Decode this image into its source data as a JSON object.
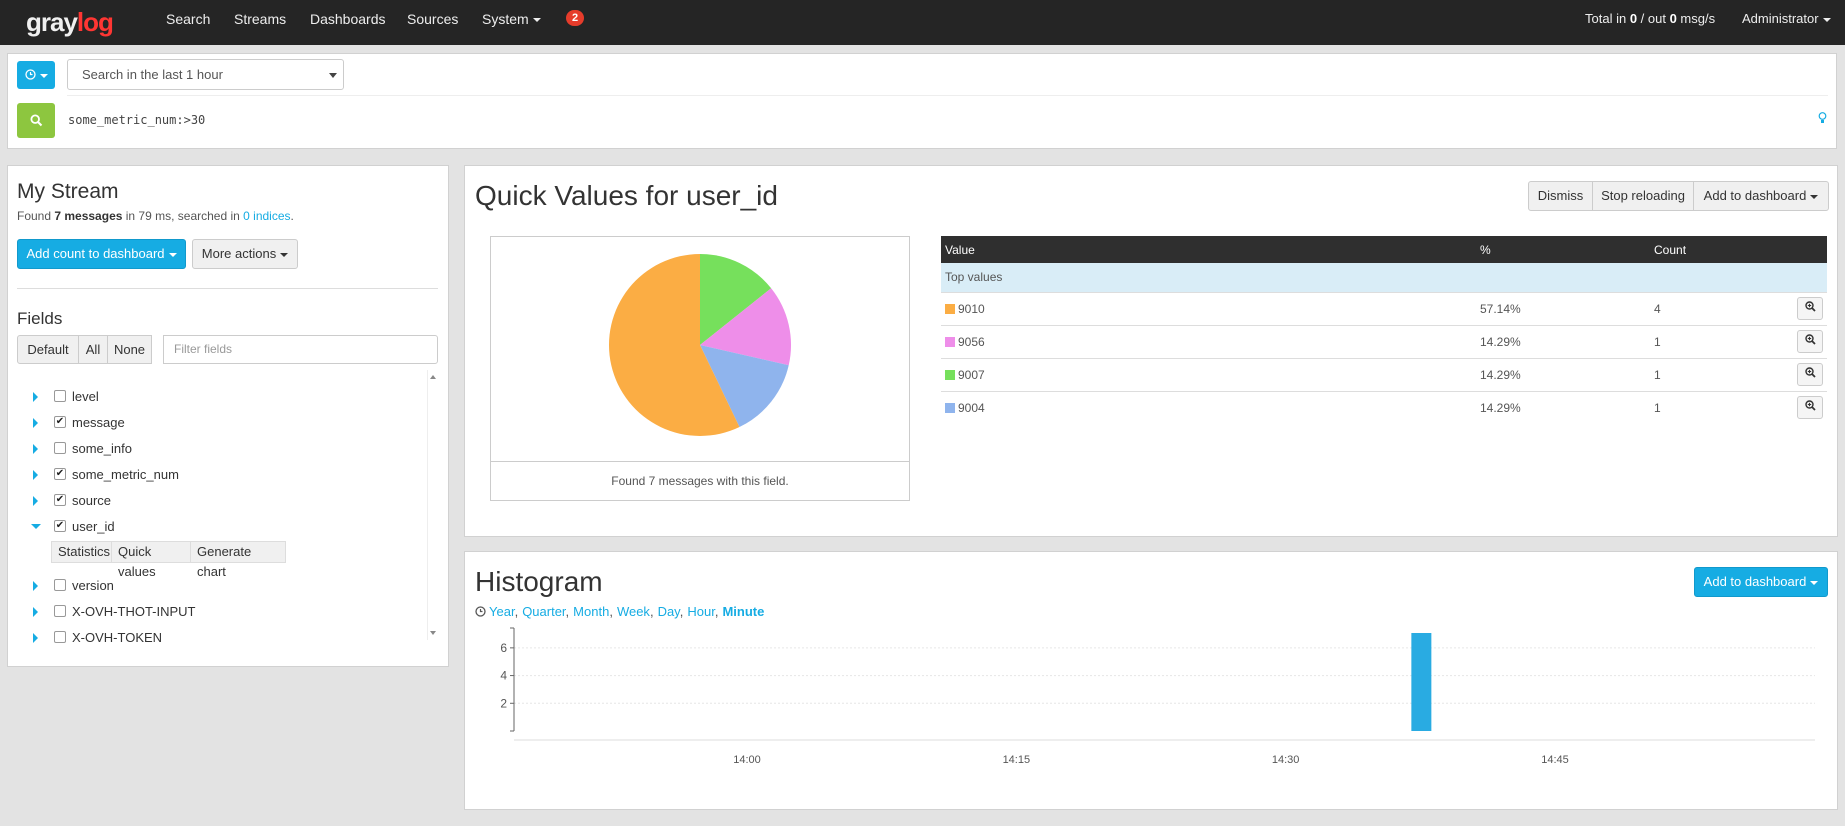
{
  "navbar": {
    "logo_gray": "gray",
    "logo_log": "log",
    "links": [
      "Search",
      "Streams",
      "Dashboards",
      "Sources",
      "System"
    ],
    "notification_count": "2",
    "throughput_prefix": "Total in ",
    "throughput_in": "0",
    "throughput_mid": " / out ",
    "throughput_out": "0",
    "throughput_suffix": " msg/s",
    "user": "Administrator"
  },
  "search": {
    "time_range": "Search in the last 1 hour",
    "query": "some_metric_num:>30"
  },
  "stream": {
    "title": "My Stream",
    "found_prefix": "Found ",
    "found_count": "7 messages",
    "found_mid": " in 79 ms, searched in ",
    "indices": "0 indices",
    "found_suffix": ".",
    "add_count_button": "Add count to dashboard",
    "more_actions_button": "More actions"
  },
  "fields": {
    "title": "Fields",
    "filter_buttons": [
      "Default",
      "All",
      "None"
    ],
    "filter_placeholder": "Filter fields",
    "items": [
      {
        "name": "level",
        "checked": false,
        "expanded": false
      },
      {
        "name": "message",
        "checked": true,
        "expanded": false
      },
      {
        "name": "some_info",
        "checked": false,
        "expanded": false
      },
      {
        "name": "some_metric_num",
        "checked": true,
        "expanded": false
      },
      {
        "name": "source",
        "checked": true,
        "expanded": false
      },
      {
        "name": "user_id",
        "checked": true,
        "expanded": true
      },
      {
        "name": "version",
        "checked": false,
        "expanded": false
      },
      {
        "name": "X-OVH-THOT-INPUT",
        "checked": false,
        "expanded": false
      },
      {
        "name": "X-OVH-TOKEN",
        "checked": false,
        "expanded": false
      }
    ],
    "sub_actions": [
      "Statistics",
      "Quick values",
      "Generate chart"
    ]
  },
  "quick_values": {
    "title": "Quick Values for user_id",
    "buttons": {
      "dismiss": "Dismiss",
      "stop": "Stop reloading",
      "add": "Add to dashboard"
    },
    "footer": "Found 7 messages with this field.",
    "table_headers": [
      "Value",
      "%",
      "Count"
    ],
    "top_values_label": "Top values",
    "rows": [
      {
        "value": "9010",
        "percent": "57.14%",
        "count": "4",
        "color": "#fbad44"
      },
      {
        "value": "9056",
        "percent": "14.29%",
        "count": "1",
        "color": "#ee8ee9"
      },
      {
        "value": "9007",
        "percent": "14.29%",
        "count": "1",
        "color": "#76e05c"
      },
      {
        "value": "9004",
        "percent": "14.29%",
        "count": "1",
        "color": "#8fb4ed"
      }
    ]
  },
  "chart_data": {
    "type": "bar",
    "title": "Histogram",
    "resolutions": [
      "Year",
      "Quarter",
      "Month",
      "Week",
      "Day",
      "Hour",
      "Minute"
    ],
    "selected_resolution": "Minute",
    "add_button": "Add to dashboard",
    "x_ticks": [
      "14:00",
      "14:15",
      "14:30",
      "14:45"
    ],
    "y_ticks": [
      2,
      4,
      6
    ],
    "ylim": [
      0,
      7
    ],
    "bars": [
      {
        "x": "14:37",
        "value": 7
      }
    ],
    "color": "#29abe2"
  }
}
